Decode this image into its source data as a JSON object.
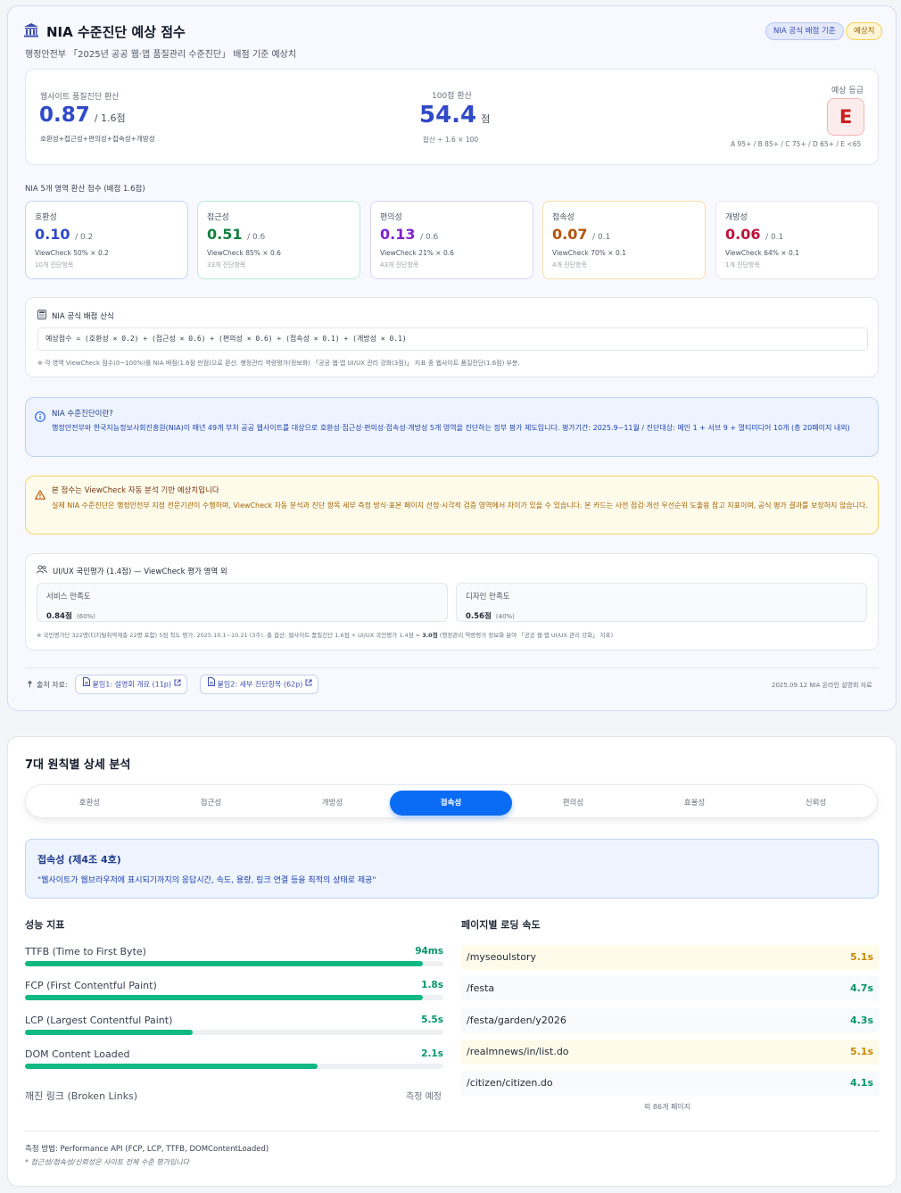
{
  "header": {
    "title": "NIA 수준진단 예상 점수",
    "subtitle": "행정안전부 「2025년 공공 웹·앱 품질관리 수준진단」 배점 기준 예상치",
    "badge_official": "NIA 공식 배점 기준",
    "badge_estimate": "예상치"
  },
  "summary": {
    "site_label": "웹사이트 품질진단 환산",
    "site_score": "0.87",
    "site_max": "/ 1.6점",
    "site_formula": "호환성+접근성+편의성+접속성+개방성",
    "hundred_label": "100점 환산",
    "hundred_score": "54.4",
    "hundred_unit": "점",
    "hundred_formula": "합산 ÷ 1.6 × 100",
    "grade_label": "예상 등급",
    "grade": "E",
    "grade_scale": "A 95+ / B 85+ / C 75+ / D 65+ / E <65"
  },
  "areas_title": "NIA 5개 영역 환산 점수 (배점 1.6점)",
  "areas": [
    {
      "name": "호환성",
      "score": "0.10",
      "max": "/ 0.2",
      "detail": "ViewCheck 50% × 0.2",
      "count": "10개 진단항목",
      "color": "#2f49c7",
      "border": "#c9d2f4"
    },
    {
      "name": "접근성",
      "score": "0.51",
      "max": "/ 0.6",
      "detail": "ViewCheck 85% × 0.6",
      "count": "33개 진단항목",
      "color": "#15803d",
      "border": "#bfe8d5"
    },
    {
      "name": "편의성",
      "score": "0.13",
      "max": "/ 0.6",
      "detail": "ViewCheck 21% × 0.6",
      "count": "43개 진단항목",
      "color": "#7e22ce",
      "border": "#dcd3f2"
    },
    {
      "name": "접속성",
      "score": "0.07",
      "max": "/ 0.1",
      "detail": "ViewCheck 70% × 0.1",
      "count": "4개 진단항목",
      "color": "#b45309",
      "border": "#f6dfa6"
    },
    {
      "name": "개방성",
      "score": "0.06",
      "max": "/ 0.1",
      "detail": "ViewCheck 64% × 0.1",
      "count": "1개 진단항목",
      "color": "#be123c",
      "border": "#e4e6ec"
    }
  ],
  "formula": {
    "title": "NIA 공식 배점 산식",
    "expression": "예상점수 = (호환성 × 0.2) + (접근성 × 0.6) + (편의성 × 0.6) + (접속성 × 0.1) + (개방성 × 0.1)",
    "note": "※ 각 영역 ViewCheck 점수(0~100%)를 NIA 배점(1.6점 만점)으로 환산. 행정관리 역량평가(정보화) 「공공 웹·앱 UI/UX 관리 강화(3점)」 지표 중 웹사이트 품질진단(1.6점) 부분."
  },
  "info": {
    "title": "NIA 수준진단이란?",
    "body": "행정안전부와 한국지능정보사회진흥원(NIA)이 매년 49개 부처 공공 웹사이트를 대상으로 호환성·접근성·편의성·접속성·개방성 5개 영역을 진단하는 정부 평가 제도입니다. 평가기간: 2025.9~11월 / 진단대상: 메인 1 + 서브 9 + 멀티미디어 10개 (총 20페이지 내외)"
  },
  "warning": {
    "title": "본 점수는 ViewCheck 자동 분석 기반 예상치입니다",
    "body": "실제 NIA 수준진단은 행정안전부 지정 전문기관이 수행하며, ViewCheck 자동 분석과 진단 항목 세부 측정 방식·표본 페이지 선정·시각적 검증 영역에서 차이가 있을 수 있습니다. 본 카드는 사전 점검·개선 우선순위 도출용 참고 지표이며, 공식 평가 결과를 보장하지 않습니다."
  },
  "uiux": {
    "title": "UI/UX 국민평가 (1.4점) — ViewCheck 평가 영역 외",
    "service_label": "서비스 만족도",
    "service_value": "0.84점",
    "service_pct": "(60%)",
    "design_label": "디자인 만족도",
    "design_value": "0.56점",
    "design_pct": "(40%)",
    "note_a": "※ 국민평가단 322명(디지털취약계층 22명 포함) 5점 척도 평가. 2025.10.1~10.21 (3주). 총 합산: 웹사이트 품질진단 1.6점 + UI/UX 국민평가 1.4점 = ",
    "note_b": "3.0점",
    "note_c": " (행정관리 역량평가 정보화 분야 「공공 웹·앱 UI/UX 관리 강화」 지표)"
  },
  "sources": {
    "label": "출처 자료:",
    "link1": "붙임1: 설명회 개요 (11p)",
    "link2": "붙임2: 세부 진단항목 (62p)",
    "date": "2025.09.12 NIA 온라인 설명회 자료"
  },
  "analysis": {
    "title": "7대 원칙별 상세 분석",
    "tabs": [
      "호환성",
      "접근성",
      "개방성",
      "접속성",
      "편의성",
      "효율성",
      "신뢰성"
    ],
    "active_tab": 3,
    "principle_title": "접속성 (제4조 4호)",
    "principle_desc": "\"웹사이트가 웹브라우저에 표시되기까지의 응답시간, 속도, 용량, 링크 연결 등을 최적의 상태로 제공\"",
    "metrics_title": "성능 지표",
    "metrics": [
      {
        "name": "TTFB (Time to First Byte)",
        "value": "94ms",
        "fill": 0.95
      },
      {
        "name": "FCP (First Contentful Paint)",
        "value": "1.8s",
        "fill": 0.95
      },
      {
        "name": "LCP (Largest Contentful Paint)",
        "value": "5.5s",
        "fill": 0.4
      },
      {
        "name": "DOM Content Loaded",
        "value": "2.1s",
        "fill": 0.7
      }
    ],
    "broken_links_label": "깨진 링크 (Broken Links)",
    "broken_links_value": "측정 예정",
    "pages_title": "페이지별 로딩 속도",
    "pages": [
      {
        "path": "/myseoulstory",
        "time": "5.1s",
        "status": "warn"
      },
      {
        "path": "/festa",
        "time": "4.7s",
        "status": "ok"
      },
      {
        "path": "/festa/garden/y2026",
        "time": "4.3s",
        "status": "ok"
      },
      {
        "path": "/realmnews/in/list.do",
        "time": "5.1s",
        "status": "warn"
      },
      {
        "path": "/citizen/citizen.do",
        "time": "4.1s",
        "status": "ok"
      }
    ],
    "pages_more": "외 86개 페이지",
    "method": "측정 방법: Performance API (FCP, LCP, TTFB, DOMContentLoaded)",
    "method_note": "* 접근성/접속성/신뢰성은 사이트 전체 수준 평가입니다"
  }
}
